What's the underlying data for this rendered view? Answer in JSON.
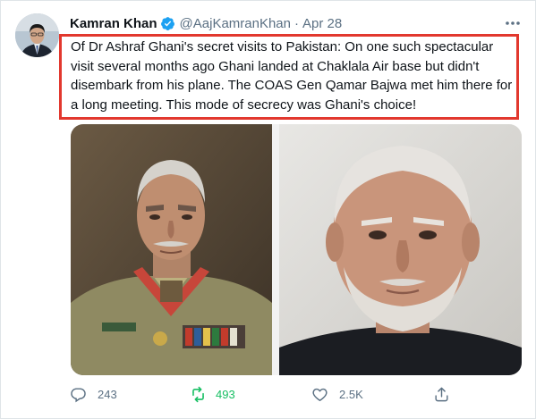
{
  "author": {
    "name": "Kamran Khan",
    "handle": "@AajKamranKhan",
    "separator": "·",
    "date": "Apr 28",
    "verified": true
  },
  "tweet": {
    "text": "Of Dr Ashraf Ghani's secret visits to Pakistan: On one such spectacular visit several months ago Ghani landed at Chaklala Air base but didn't disembark from his plane. The COAS Gen Qamar Bajwa met him there for a long meeting. This mode of secrecy was Ghani's choice!",
    "highlight_color": "#e2382e"
  },
  "media": {
    "left_image": "uniformed-general-portrait",
    "right_image": "man-with-beard-portrait"
  },
  "actions": {
    "reply_count": "243",
    "retweet_count": "493",
    "like_count": "2.5K",
    "retweeted": true
  },
  "colors": {
    "verified_blue": "#1da1f2",
    "retweet_green": "#17bf63",
    "muted_text": "#5b7083"
  }
}
